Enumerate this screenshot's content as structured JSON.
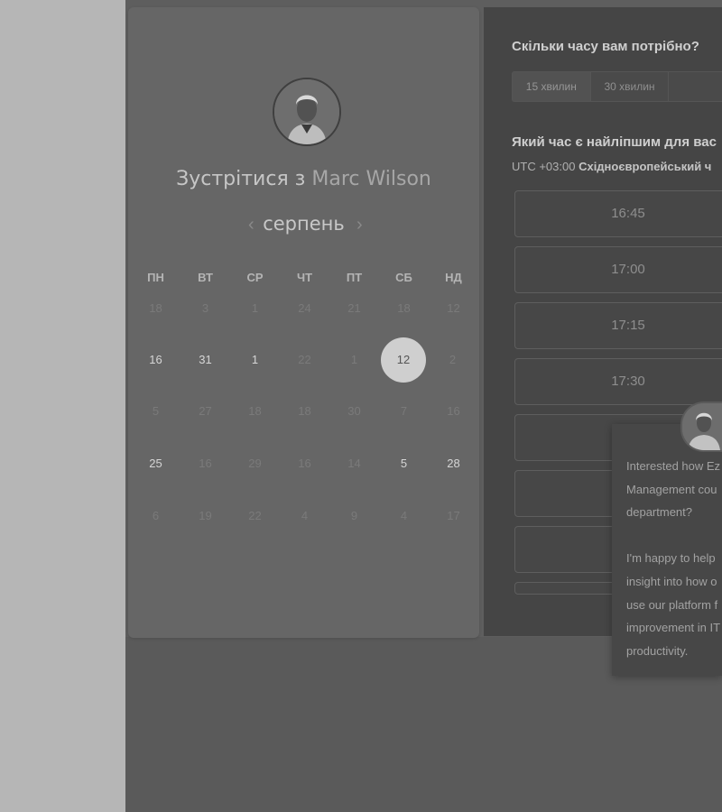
{
  "host": {
    "title_prefix": "Зустрітися з",
    "name": "Marc Wilson"
  },
  "calendar": {
    "month": "серпень",
    "prev_icon": "chevron-left-icon",
    "next_icon": "chevron-right-icon",
    "weekdays": [
      "ПН",
      "ВТ",
      "СР",
      "ЧТ",
      "ПТ",
      "СБ",
      "НД"
    ],
    "weeks": [
      [
        {
          "d": "18",
          "a": false
        },
        {
          "d": "3",
          "a": false
        },
        {
          "d": "1",
          "a": false
        },
        {
          "d": "24",
          "a": false
        },
        {
          "d": "21",
          "a": false
        },
        {
          "d": "18",
          "a": false
        },
        {
          "d": "12",
          "a": false
        }
      ],
      [
        {
          "d": "16",
          "a": true
        },
        {
          "d": "31",
          "a": true
        },
        {
          "d": "1",
          "a": true
        },
        {
          "d": "22",
          "a": false
        },
        {
          "d": "1",
          "a": false
        },
        {
          "d": "12",
          "a": true,
          "selected": true
        },
        {
          "d": "2",
          "a": false
        }
      ],
      [
        {
          "d": "5",
          "a": false
        },
        {
          "d": "27",
          "a": false
        },
        {
          "d": "18",
          "a": false
        },
        {
          "d": "18",
          "a": false
        },
        {
          "d": "30",
          "a": false
        },
        {
          "d": "7",
          "a": false
        },
        {
          "d": "16",
          "a": false
        }
      ],
      [
        {
          "d": "25",
          "a": true
        },
        {
          "d": "16",
          "a": false
        },
        {
          "d": "29",
          "a": false
        },
        {
          "d": "16",
          "a": false
        },
        {
          "d": "14",
          "a": false
        },
        {
          "d": "5",
          "a": true
        },
        {
          "d": "28",
          "a": true
        }
      ],
      [
        {
          "d": "6",
          "a": false
        },
        {
          "d": "19",
          "a": false
        },
        {
          "d": "22",
          "a": false
        },
        {
          "d": "4",
          "a": false
        },
        {
          "d": "9",
          "a": false
        },
        {
          "d": "4",
          "a": false
        },
        {
          "d": "17",
          "a": false
        }
      ]
    ]
  },
  "booking": {
    "duration_question": "Скільки часу вам потрібно?",
    "durations": [
      "15 хвилин",
      "30 хвилин",
      ""
    ],
    "time_question": "Який час є найліпшим для вас",
    "timezone_offset": "UTC +03:00",
    "timezone_name": "Східноєвропейський ч",
    "slots": [
      "16:45",
      "17:00",
      "17:15",
      "17:30",
      "",
      "",
      "",
      ""
    ]
  },
  "chat": {
    "message": "Interested how Ez\nManagement cou\ndepartment?\n\nI'm happy to help\ninsight into how o\nuse our platform f\nimprovement in IT\nproductivity."
  },
  "colors": {
    "overlay": "#5a5a5a",
    "left_strip": "#b6b6b6",
    "selected_day": "#cfcfcf"
  }
}
